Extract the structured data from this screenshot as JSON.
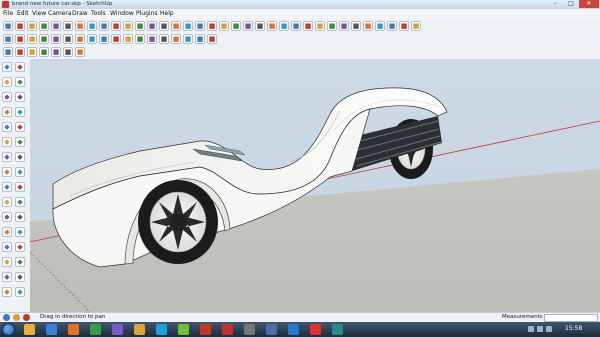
{
  "window": {
    "title": "brand new future car.skp - SketchUp",
    "minimize": "–",
    "maximize": "□",
    "close": "✕"
  },
  "menu": [
    "File",
    "Edit",
    "View",
    "Camera",
    "Draw",
    "Tools",
    "Window",
    "Plugins",
    "Help"
  ],
  "toolbars": {
    "row1": [
      "select-arrow-icon",
      "eraser-icon",
      "pencil-icon",
      "arc-icon",
      "rectangle-icon",
      "circle-icon",
      "polygon-icon",
      "move-icon",
      "pushpull-icon",
      "rotate-icon",
      "followme-icon",
      "scale-icon",
      "offset-icon",
      "tape-measure-icon",
      "dimension-icon",
      "protractor-icon",
      "text-icon",
      "axes-icon",
      "3d-text-icon",
      "orbit-icon",
      "pan-icon",
      "zoom-icon",
      "zoom-window-icon",
      "zoom-extents-icon",
      "previous-view-icon",
      "next-view-icon",
      "walk-icon",
      "look-around-icon",
      "position-camera-icon",
      "section-plane-icon",
      "components-icon",
      "materials-icon",
      "shadow-icon",
      "fog-icon",
      "styles-icon"
    ],
    "row2": [
      "display-section-icon",
      "xray-icon",
      "back-edges-icon",
      "wireframe-icon",
      "hidden-line-icon",
      "shaded-icon",
      "shaded-texture-icon",
      "monochrome-icon",
      "iso-view-icon",
      "top-view-icon",
      "front-view-icon",
      "right-view-icon",
      "back-view-icon",
      "left-view-icon",
      "sun-icon",
      "move-sun-icon",
      "bird-icon",
      "bug-icon"
    ],
    "row3": [
      "sandbox-contours-icon",
      "sandbox-scratch-icon",
      "smoove-icon",
      "stamp-icon",
      "drape-icon",
      "add-detail-icon",
      "flip-edge-icon"
    ],
    "left": [
      "select-icon",
      "component-icon",
      "paint-icon",
      "eraser-icon",
      "rectangle-icon",
      "line-icon",
      "circle-icon",
      "arc-icon",
      "polygon-icon",
      "freehand-icon",
      "move-icon",
      "pushpull-icon",
      "rotate-icon",
      "followme-icon",
      "scale-icon",
      "offset-icon",
      "tape-icon",
      "dimension-icon",
      "protractor-icon",
      "text-icon",
      "axes-icon",
      "3d-text-icon",
      "orbit-icon",
      "pan-icon",
      "zoom-icon",
      "zoom-window-icon",
      "zoom-extents-icon",
      "previous-icon",
      "position-camera-icon",
      "look-around-icon",
      "walk-icon",
      "section-icon"
    ]
  },
  "status": {
    "message": "Drag in direction to pan",
    "measurements_label": "Measurements",
    "measurements_value": ""
  },
  "taskbar": {
    "clock": "15:58",
    "apps": [
      "explorer-icon",
      "media-icon",
      "firefox-icon",
      "chrome-icon",
      "photo-icon",
      "folder-icon",
      "skype-icon",
      "utorrent-icon",
      "sketchup-icon",
      "acrobat-icon",
      "settings-icon",
      "network-icon",
      "ie-icon",
      "opera-icon",
      "game-icon"
    ]
  },
  "colors": {
    "sky": "#c9d6e3",
    "ground": "#c3c4c0",
    "axis_red": "#c0392b",
    "car_body": "#f7f7f6",
    "wheel": "#1b1b1b"
  }
}
